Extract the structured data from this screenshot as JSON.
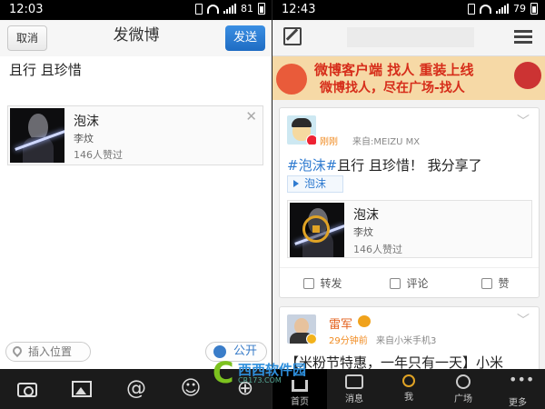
{
  "left": {
    "status": {
      "time": "12:03",
      "battery": "81"
    },
    "header": {
      "cancel": "取消",
      "title": "发微博",
      "send": "发送"
    },
    "compose_text": "且行 且珍惜",
    "attachment": {
      "title": "泡沫",
      "artist": "李炆",
      "likes": "146人赞过"
    },
    "location_label": "插入位置",
    "visibility_label": "公开",
    "toolbar": [
      "camera-icon",
      "image-icon",
      "@",
      "emoji-icon",
      "add-icon"
    ]
  },
  "right": {
    "status": {
      "time": "12:43",
      "battery": "79"
    },
    "banner": {
      "line1": "微博客户端 找人 重装上线",
      "line2": "微博找人，尽在广场-找人"
    },
    "post1": {
      "time": "刚刚",
      "source": "来自:MEIZU MX",
      "tag": "#泡沫#",
      "text": "且行 且珍惜！ 我分享了",
      "video_tag": "泡沫",
      "card": {
        "title": "泡沫",
        "artist": "李炆",
        "likes": "146人赞过"
      },
      "actions": [
        "转发",
        "评论",
        "赞"
      ]
    },
    "post2": {
      "name": "雷军",
      "time": "29分钟前",
      "source": "来自小米手机3",
      "text": "【米粉节特惠，一年只有一天】小米"
    },
    "nav": [
      "首页",
      "消息",
      "我",
      "广场",
      "更多"
    ]
  },
  "watermark": {
    "logo": "C",
    "name": "西西软件园",
    "url": "CR173.COM"
  }
}
